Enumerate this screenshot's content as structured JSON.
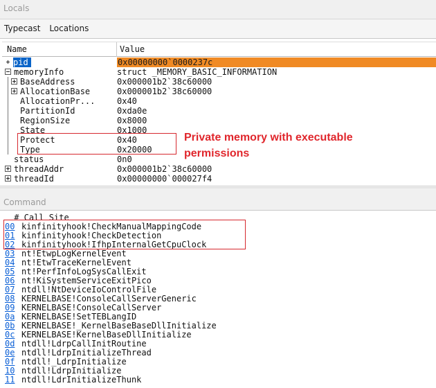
{
  "locals_pane": {
    "title": "Locals",
    "toolbar": {
      "typecast": "Typecast",
      "locations": "Locations"
    },
    "columns": {
      "name": "Name",
      "value": "Value"
    },
    "rows": [
      {
        "name": "pid",
        "value": "0x00000000`0000237c"
      },
      {
        "name": "memoryInfo",
        "value": "struct _MEMORY_BASIC_INFORMATION"
      },
      {
        "name": "BaseAddress",
        "value": "0x000001b2`38c60000"
      },
      {
        "name": "AllocationBase",
        "value": "0x000001b2`38c60000"
      },
      {
        "name": "AllocationPr...",
        "value": "0x40"
      },
      {
        "name": "PartitionId",
        "value": "0xda0e"
      },
      {
        "name": "RegionSize",
        "value": "0x8000"
      },
      {
        "name": "State",
        "value": "0x1000"
      },
      {
        "name": "Protect",
        "value": "0x40"
      },
      {
        "name": "Type",
        "value": "0x20000"
      },
      {
        "name": "status",
        "value": "0n0"
      },
      {
        "name": "threadAddr",
        "value": "0x000001b2`38c60000"
      },
      {
        "name": "threadId",
        "value": "0x00000000`000027f4"
      }
    ]
  },
  "annotation": {
    "line1": "Private memory with executable",
    "line2": "permissions"
  },
  "command_pane": {
    "title": "Command",
    "header": " # Call Site",
    "frames": [
      {
        "num": "00",
        "site": "kinfinityhook!CheckManualMappingCode"
      },
      {
        "num": "01",
        "site": "kinfinityhook!CheckDetection"
      },
      {
        "num": "02",
        "site": "kinfinityhook!IfhpInternalGetCpuClock"
      },
      {
        "num": "03",
        "site": "nt!EtwpLogKernelEvent"
      },
      {
        "num": "04",
        "site": "nt!EtwTraceKernelEvent"
      },
      {
        "num": "05",
        "site": "nt!PerfInfoLogSysCallExit"
      },
      {
        "num": "06",
        "site": "nt!KiSystemServiceExitPico"
      },
      {
        "num": "07",
        "site": "ntdll!NtDeviceIoControlFile"
      },
      {
        "num": "08",
        "site": "KERNELBASE!ConsoleCallServerGeneric"
      },
      {
        "num": "09",
        "site": "KERNELBASE!ConsoleCallServer"
      },
      {
        "num": "0a",
        "site": "KERNELBASE!SetTEBLangID"
      },
      {
        "num": "0b",
        "site": "KERNELBASE!_KernelBaseBaseDllInitialize"
      },
      {
        "num": "0c",
        "site": "KERNELBASE!KernelBaseDllInitialize"
      },
      {
        "num": "0d",
        "site": "ntdll!LdrpCallInitRoutine"
      },
      {
        "num": "0e",
        "site": "ntdll!LdrpInitializeThread"
      },
      {
        "num": "0f",
        "site": "ntdll!_LdrpInitialize"
      },
      {
        "num": "10",
        "site": "ntdll!LdrpInitialize"
      },
      {
        "num": "11",
        "site": "ntdll!LdrInitializeThunk"
      }
    ]
  },
  "colors": {
    "selection_name": "#0a64c8",
    "selection_value": "#f08a24",
    "highlight": "#d6282e",
    "link": "#0a5fd6"
  }
}
